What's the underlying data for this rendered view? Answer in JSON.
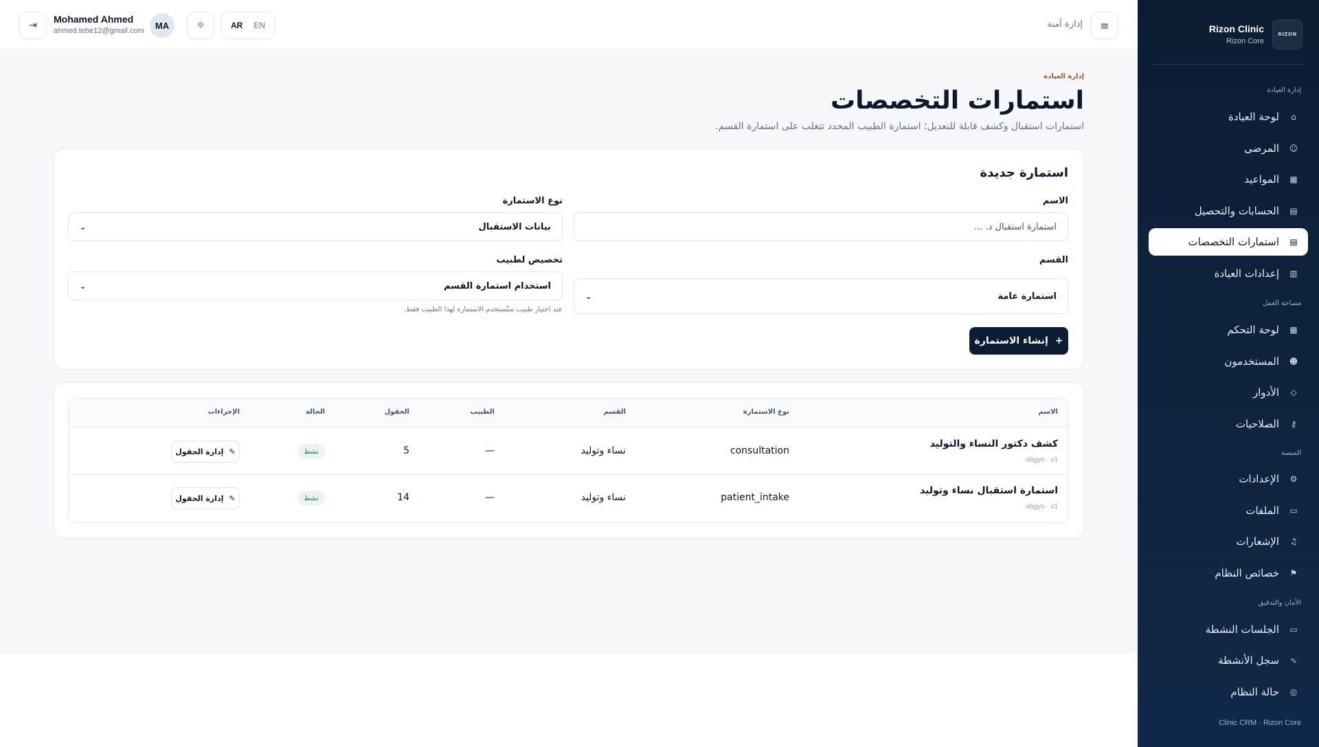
{
  "sidebar": {
    "brand_name": "Rizon Clinic",
    "brand_sub": "Rizon Core",
    "logo_text": "RIZON",
    "sections": {
      "clinic": "إدارة العيادة",
      "workspace": "مساحة العمل",
      "platform": "المنصة",
      "security": "الأمان والتدقيق"
    },
    "items": [
      {
        "label": "لوحة العيادة",
        "icon": "clinic-icon"
      },
      {
        "label": "المرضى",
        "icon": "patient-icon"
      },
      {
        "label": "المواعيد",
        "icon": "calendar-icon"
      },
      {
        "label": "الحسابات والتحصيل",
        "icon": "billing-icon"
      },
      {
        "label": "استمارات التخصصات",
        "icon": "form-icon",
        "active": true
      },
      {
        "label": "إعدادات العيادة",
        "icon": "building-icon"
      },
      {
        "label": "لوحة التحكم",
        "icon": "grid-icon"
      },
      {
        "label": "المستخدمون",
        "icon": "users-icon"
      },
      {
        "label": "الأدوار",
        "icon": "shield-icon"
      },
      {
        "label": "الصلاحيات",
        "icon": "key-icon"
      },
      {
        "label": "الإعدادات",
        "icon": "gear-icon"
      },
      {
        "label": "الملفات",
        "icon": "folder-icon"
      },
      {
        "label": "الإشعارات",
        "icon": "bell-icon"
      },
      {
        "label": "خصائص النظام",
        "icon": "flag-icon"
      },
      {
        "label": "الجلسات النشطة",
        "icon": "monitor-icon"
      },
      {
        "label": "سجل الأنشطة",
        "icon": "activity-icon"
      },
      {
        "label": "حالة النظام",
        "icon": "status-icon"
      }
    ],
    "footer": "Clinic CRM · Rizon Core"
  },
  "topbar": {
    "title": "إدارة آمنة",
    "user_name": "Mohamed Ahmed",
    "user_email": "ahmed.tebe12@gmail.com",
    "avatar_initials": "MA",
    "lang_active": "AR",
    "lang_inactive": "EN"
  },
  "page": {
    "breadcrumb": "إدارة العيادة",
    "title": "استمارات التخصصات",
    "subtitle": "استمارات استقبال وكشف قابلة للتعديل؛ استمارة الطبيب المحدد تتغلب على استمارة القسم."
  },
  "form": {
    "card_title": "استمارة جديدة",
    "name_label": "الاسم",
    "name_placeholder": "استمارة استقبال د. ...",
    "type_label": "نوع الاستمارة",
    "type_value": "بيانات الاستقبال",
    "dept_label": "القسم",
    "dept_value": "استمارة عامة",
    "doctor_label": "تخصيص لطبيب",
    "doctor_value": "استخدام استمارة القسم",
    "doctor_hint": "عند اختيار طبيب ستُستخدم الاستمارة لهذا الطبيب فقط.",
    "submit_label": "إنشاء الاستمارة"
  },
  "table": {
    "headers": {
      "name": "الاسم",
      "type": "نوع الاستمارة",
      "dept": "القسم",
      "doctor": "الطبيب",
      "fields": "الحقول",
      "status": "الحالة",
      "actions": "الإجراءات"
    },
    "rows": [
      {
        "name": "كشف دكتور النساء والتوليد",
        "meta": "obgyn · v1",
        "type": "consultation",
        "dept": "نساء وتوليد",
        "doctor": "—",
        "fields": "5",
        "status": "نشط",
        "action": "إدارة الحقول"
      },
      {
        "name": "استمارة استقبال نساء وتوليد",
        "meta": "obgyn · v1",
        "type": "patient_intake",
        "dept": "نساء وتوليد",
        "doctor": "—",
        "fields": "14",
        "status": "نشط",
        "action": "إدارة الحقول"
      }
    ]
  }
}
